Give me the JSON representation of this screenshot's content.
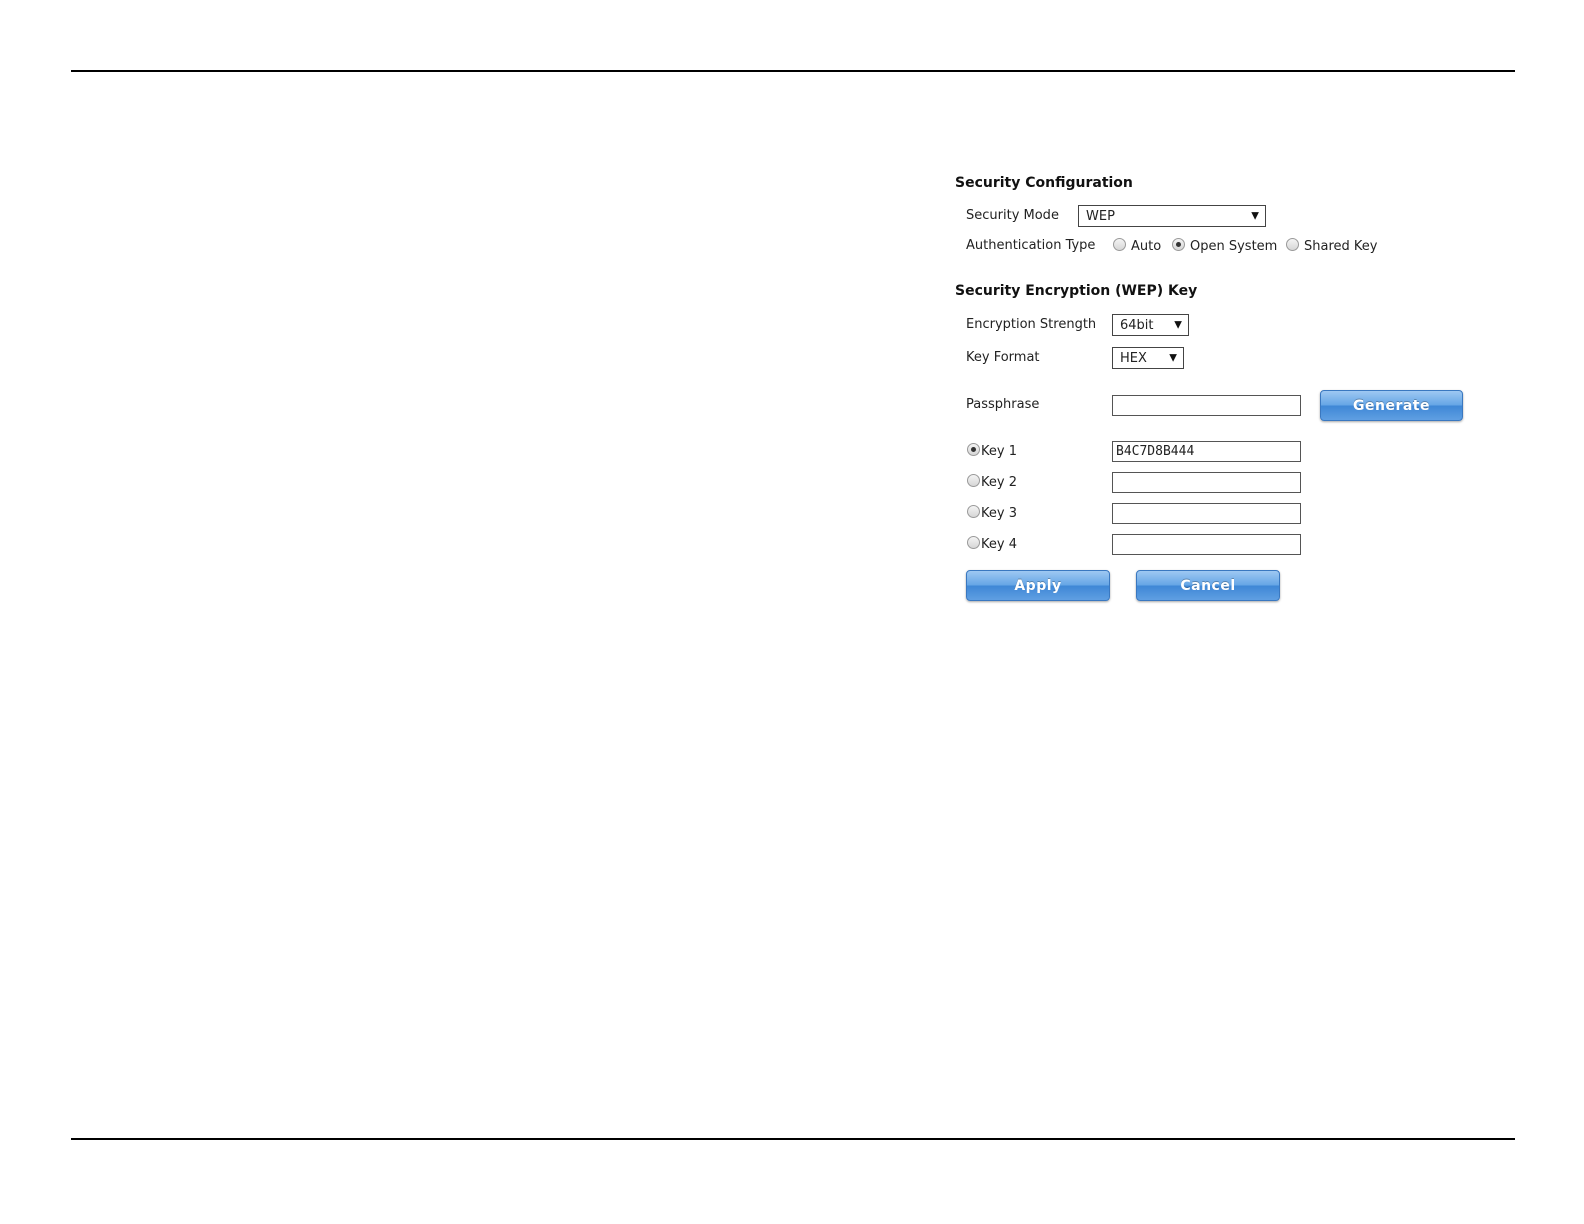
{
  "security_configuration": {
    "heading": "Security Configuration",
    "security_mode": {
      "label": "Security Mode",
      "value": "WEP"
    },
    "authentication_type": {
      "label": "Authentication Type",
      "options": [
        "Auto",
        "Open System",
        "Shared Key"
      ],
      "selected": "Open System"
    }
  },
  "wep_key": {
    "heading": "Security Encryption (WEP) Key",
    "encryption_strength": {
      "label": "Encryption Strength",
      "value": "64bit"
    },
    "key_format": {
      "label": "Key Format",
      "value": "HEX"
    },
    "passphrase": {
      "label": "Passphrase",
      "value": ""
    },
    "generate_label": "Generate",
    "keys": [
      {
        "label": "Key 1",
        "value": "B4C7D8B444",
        "selected": true
      },
      {
        "label": "Key 2",
        "value": "",
        "selected": false
      },
      {
        "label": "Key 3",
        "value": "",
        "selected": false
      },
      {
        "label": "Key 4",
        "value": "",
        "selected": false
      }
    ]
  },
  "actions": {
    "apply_label": "Apply",
    "cancel_label": "Cancel"
  },
  "icons": {
    "dropdown": "chevron-down-icon",
    "radio": "radio-icon"
  },
  "colors": {
    "button_blue": "#4a90dc",
    "rule": "#000000"
  }
}
